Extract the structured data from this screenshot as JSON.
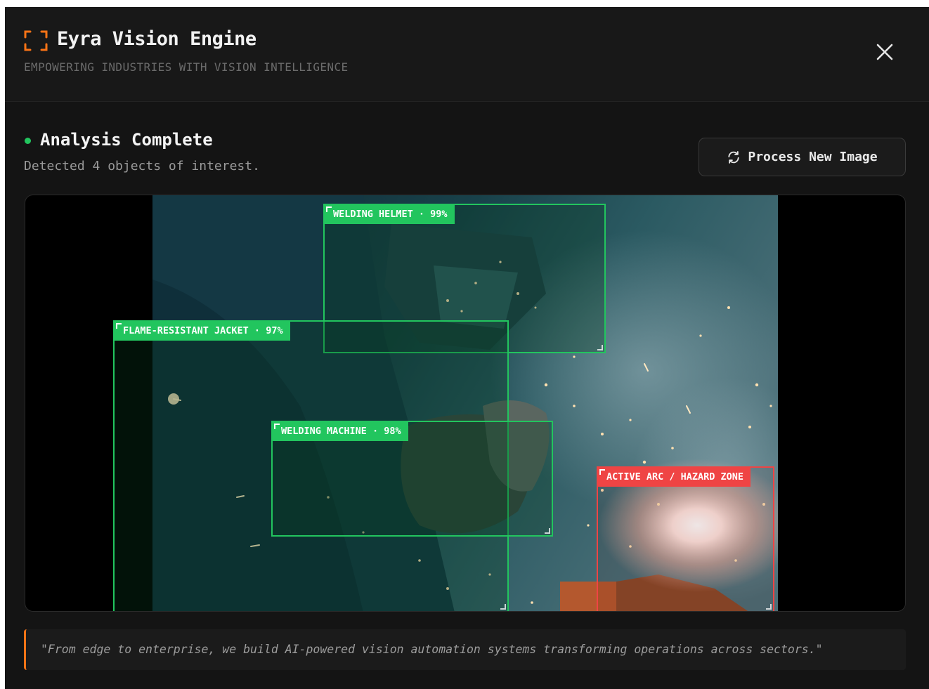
{
  "header": {
    "title": "Eyra Vision Engine",
    "tagline": "EMPOWERING INDUSTRIES WITH VISION INTELLIGENCE",
    "logo_icon": "scan-focus-icon",
    "close_icon": "close-icon"
  },
  "status": {
    "title": "Analysis Complete",
    "subtitle": "Detected 4 objects of interest.",
    "color": "#22c55e"
  },
  "actions": {
    "process_label": "Process New Image",
    "process_icon": "refresh-icon"
  },
  "detections": [
    {
      "label": "WELDING HELMET · 99%",
      "type": "safe"
    },
    {
      "label": "FLAME-RESISTANT JACKET · 97%",
      "type": "safe"
    },
    {
      "label": "WELDING MACHINE · 98%",
      "type": "safe"
    },
    {
      "label": "ACTIVE ARC / HAZARD ZONE",
      "type": "hazard"
    }
  ],
  "footer": {
    "quote": "\"From edge to enterprise, we build AI-powered vision automation systems transforming operations across sectors.\""
  },
  "colors": {
    "accent": "#f97316",
    "safe": "#22c55e",
    "hazard": "#ef4444",
    "background": "#141414"
  }
}
